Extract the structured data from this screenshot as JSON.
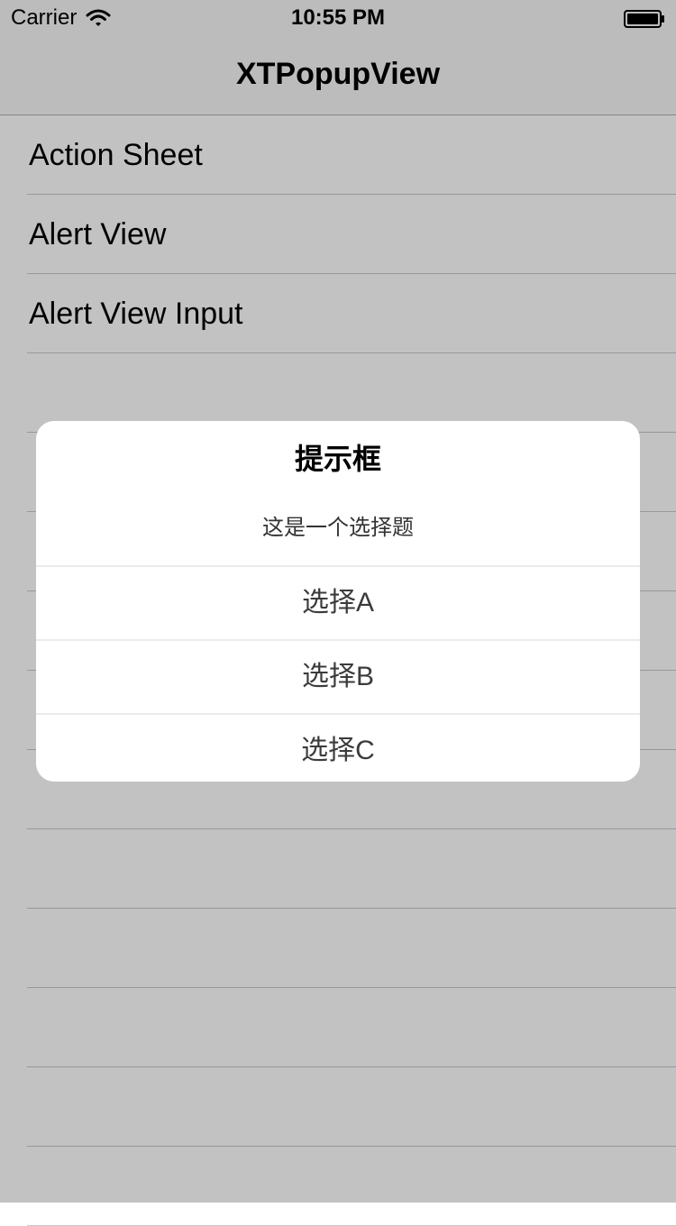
{
  "status_bar": {
    "carrier": "Carrier",
    "time": "10:55 PM"
  },
  "nav": {
    "title": "XTPopupView"
  },
  "table": {
    "items": [
      {
        "label": "Action Sheet"
      },
      {
        "label": "Alert View"
      },
      {
        "label": "Alert View Input"
      },
      {
        "label": ""
      },
      {
        "label": ""
      },
      {
        "label": ""
      },
      {
        "label": ""
      },
      {
        "label": ""
      },
      {
        "label": ""
      },
      {
        "label": ""
      },
      {
        "label": ""
      },
      {
        "label": ""
      },
      {
        "label": ""
      },
      {
        "label": ""
      }
    ]
  },
  "alert": {
    "title": "提示框",
    "message": "这是一个选择题",
    "actions": [
      {
        "label": "选择A"
      },
      {
        "label": "选择B"
      },
      {
        "label": "选择C"
      }
    ]
  },
  "icons": {
    "wifi": "wifi-icon",
    "battery": "battery-icon"
  },
  "colors": {
    "overlay": "#000000",
    "separator": "#c8c7cc",
    "alert_background": "#ffffff"
  }
}
